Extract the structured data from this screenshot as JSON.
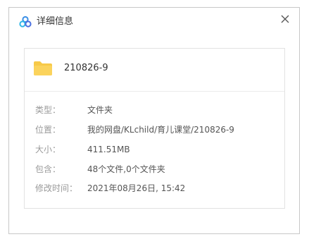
{
  "dialog": {
    "title": "详细信息",
    "close_icon": "close-icon",
    "logo_icon": "cloud-logo-icon",
    "colors": {
      "folder": "#f7c948",
      "logo_blue": "#3a8ee6"
    }
  },
  "file": {
    "icon": "folder-icon",
    "name": "210826-9"
  },
  "details": [
    {
      "label": "类型：",
      "value": "文件夹"
    },
    {
      "label": "位置：",
      "value": "我的网盘/KLchild/育儿课堂/210826-9"
    },
    {
      "label": "大小：",
      "value": "411.51MB"
    },
    {
      "label": "包含：",
      "value": "48个文件,0个文件夹"
    },
    {
      "label": "修改时间：",
      "value": "2021年08月26日, 15:42"
    }
  ]
}
